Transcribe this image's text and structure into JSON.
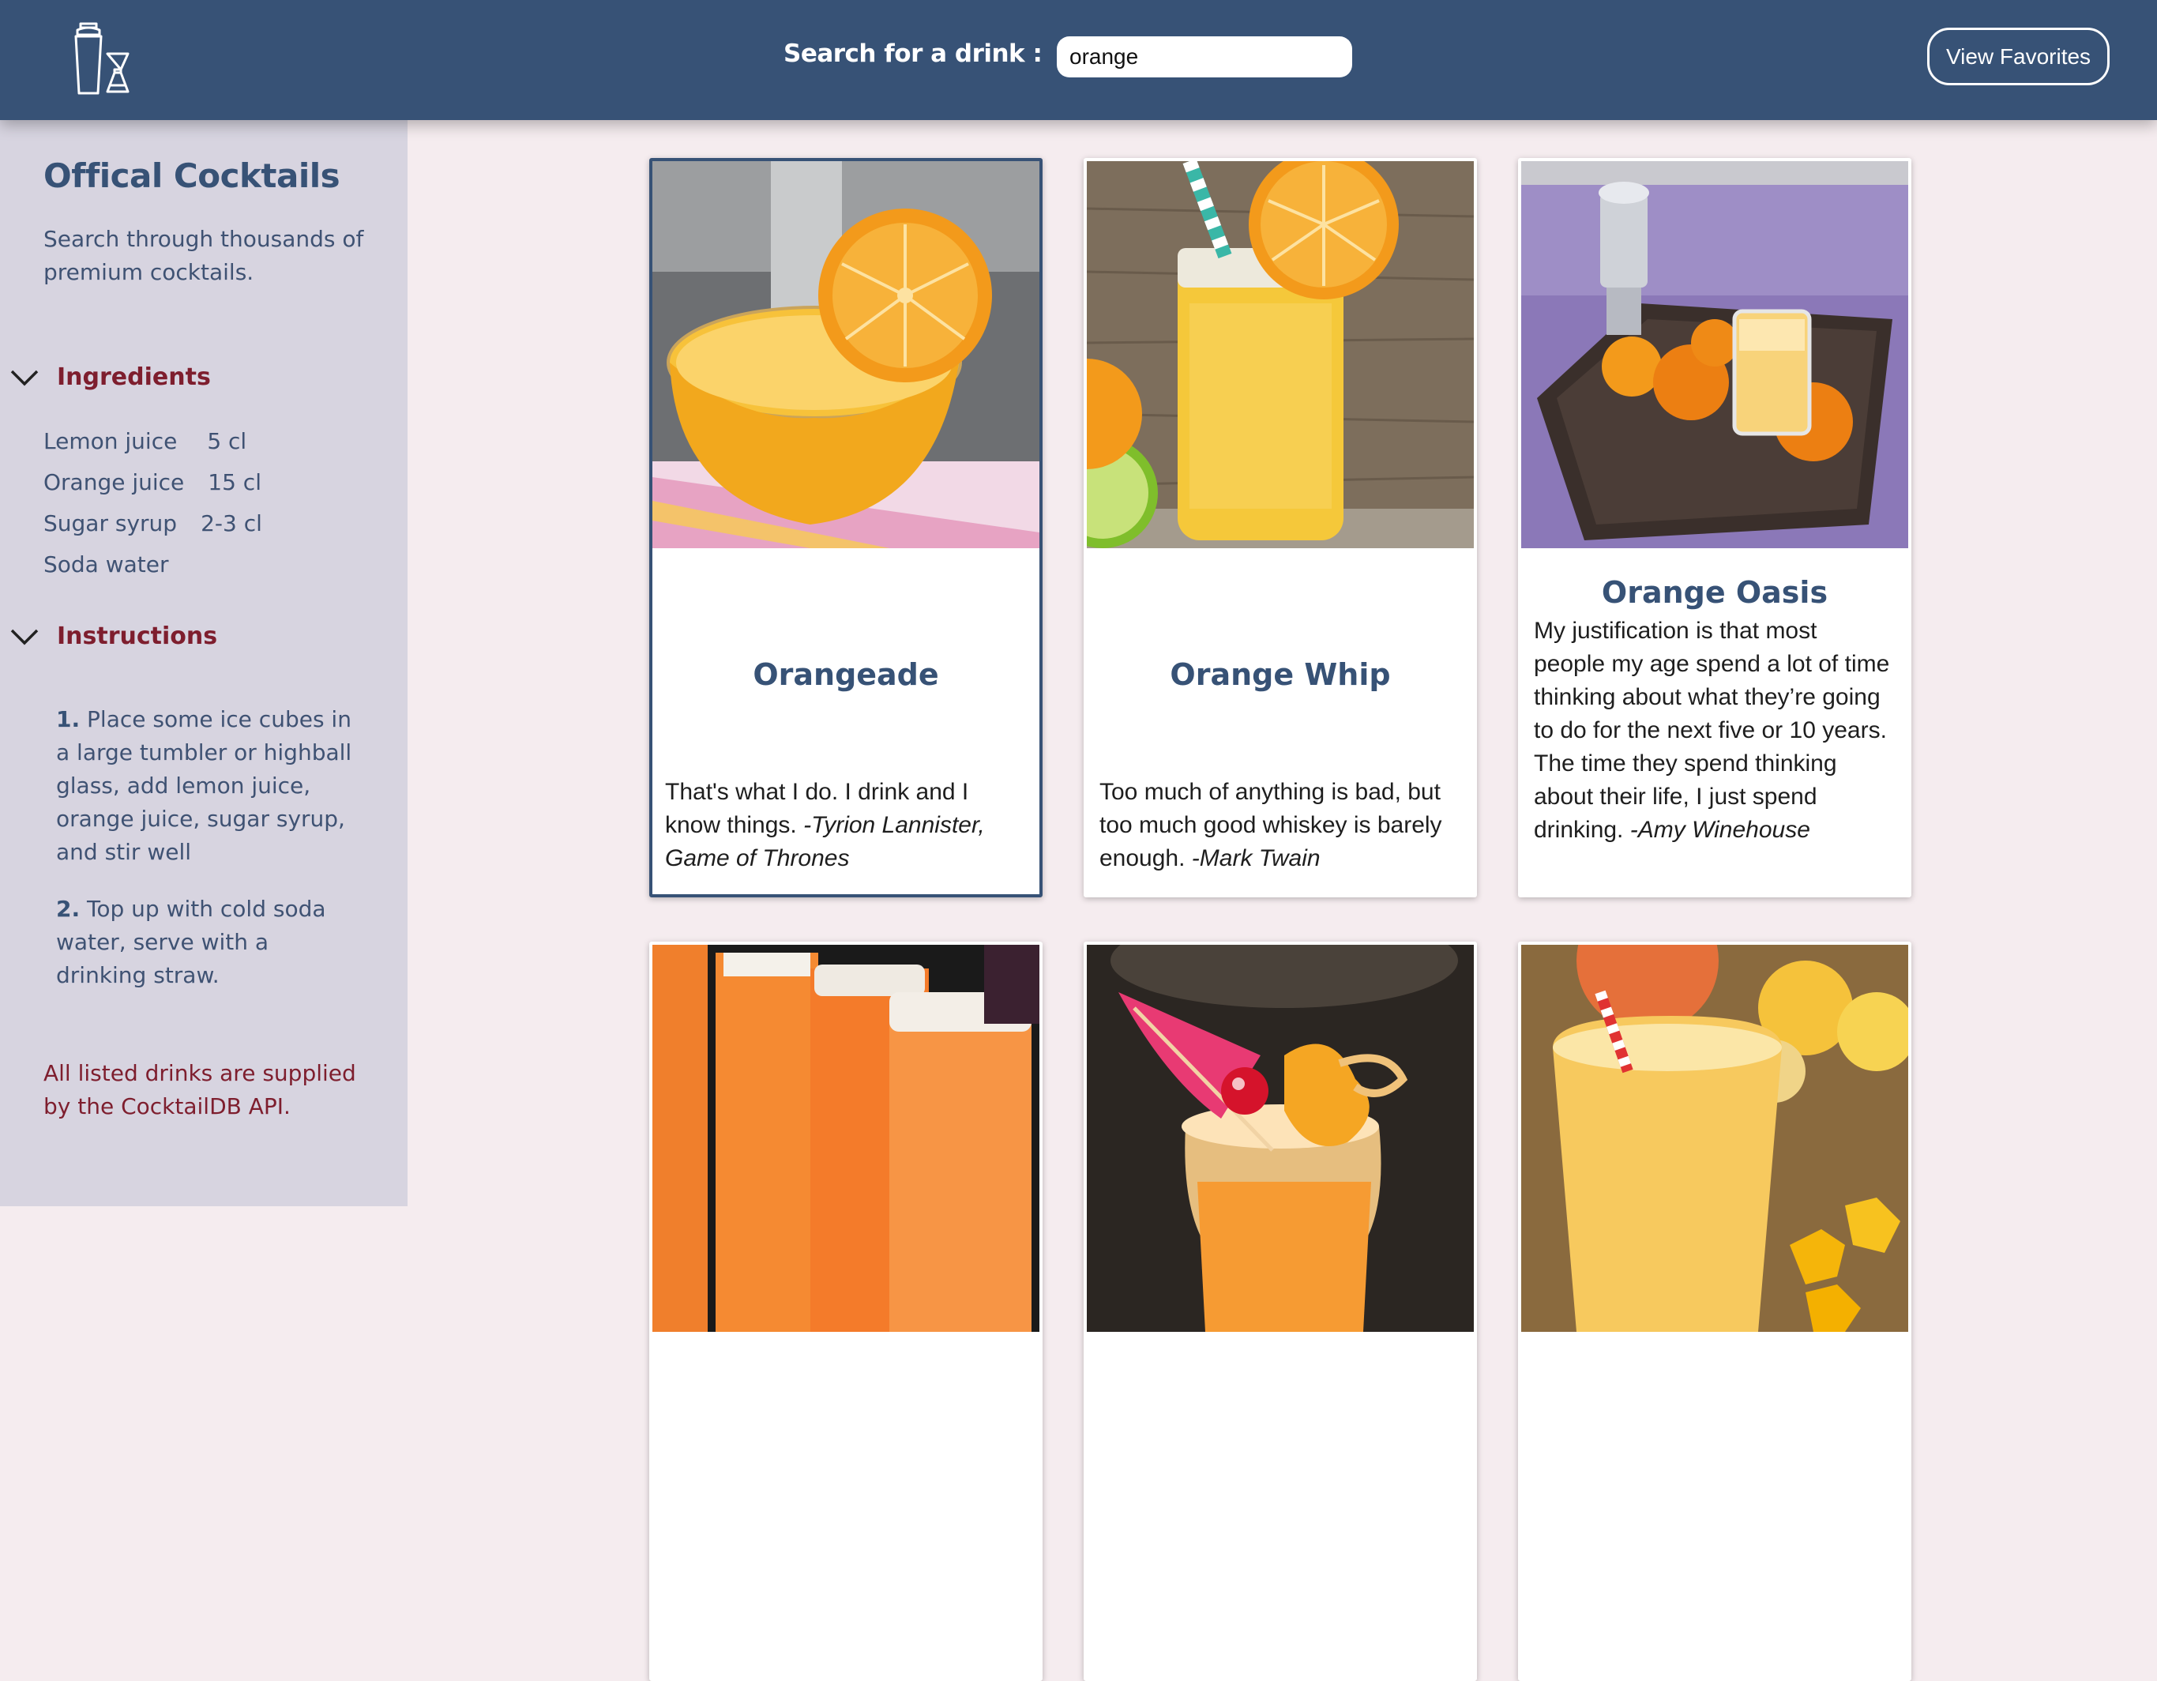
{
  "header": {
    "search_label": "Search for a drink :",
    "search_value": "orange",
    "favorites_label": "View Favorites"
  },
  "sidebar": {
    "title": "Offical Cocktails",
    "description": "Search through thousands of premium cocktails.",
    "ingredients_heading": "Ingredients",
    "ingredients": [
      {
        "name": "Lemon juice",
        "qty": "5 cl"
      },
      {
        "name": "Orange juice",
        "qty": "15 cl"
      },
      {
        "name": "Sugar syrup",
        "qty": "2-3 cl"
      },
      {
        "name": "Soda water",
        "qty": ""
      }
    ],
    "instructions_heading": "Instructions",
    "steps": [
      {
        "num": "1.",
        "text": "Place some ice cubes in a large tumbler or highball glass, add lemon juice, orange juice, sugar syrup, and stir well"
      },
      {
        "num": "2.",
        "text": "Top up with cold soda water, serve with a drinking straw."
      }
    ],
    "footnote": "All listed drinks are supplied by the CocktailDB API."
  },
  "cards": [
    {
      "title": "Orangeade",
      "quote": "That's what I do. I drink and I know things.",
      "author": "-Tyrion Lannister, Game of Thrones",
      "active": true
    },
    {
      "title": "Orange Whip",
      "quote": "Too much of anything is bad, but too much good whiskey is barely enough.",
      "author": "-Mark Twain",
      "active": false
    },
    {
      "title": "Orange Oasis",
      "quote": "My justification is that most people my age spend a lot of time thinking about what they’re going to do for the next five or 10 years. The time they spend thinking about their life, I just spend drinking.",
      "author": "-Amy Winehouse",
      "active": false
    }
  ],
  "icons": {
    "logo": "cocktail-shaker-jigger-icon",
    "chevrons": "chevron-down-icon"
  },
  "colors": {
    "header_bg": "#375276",
    "sidebar_bg": "#d7d4e0",
    "page_bg": "#f5ecef",
    "accent_red": "#7e1e2e"
  }
}
